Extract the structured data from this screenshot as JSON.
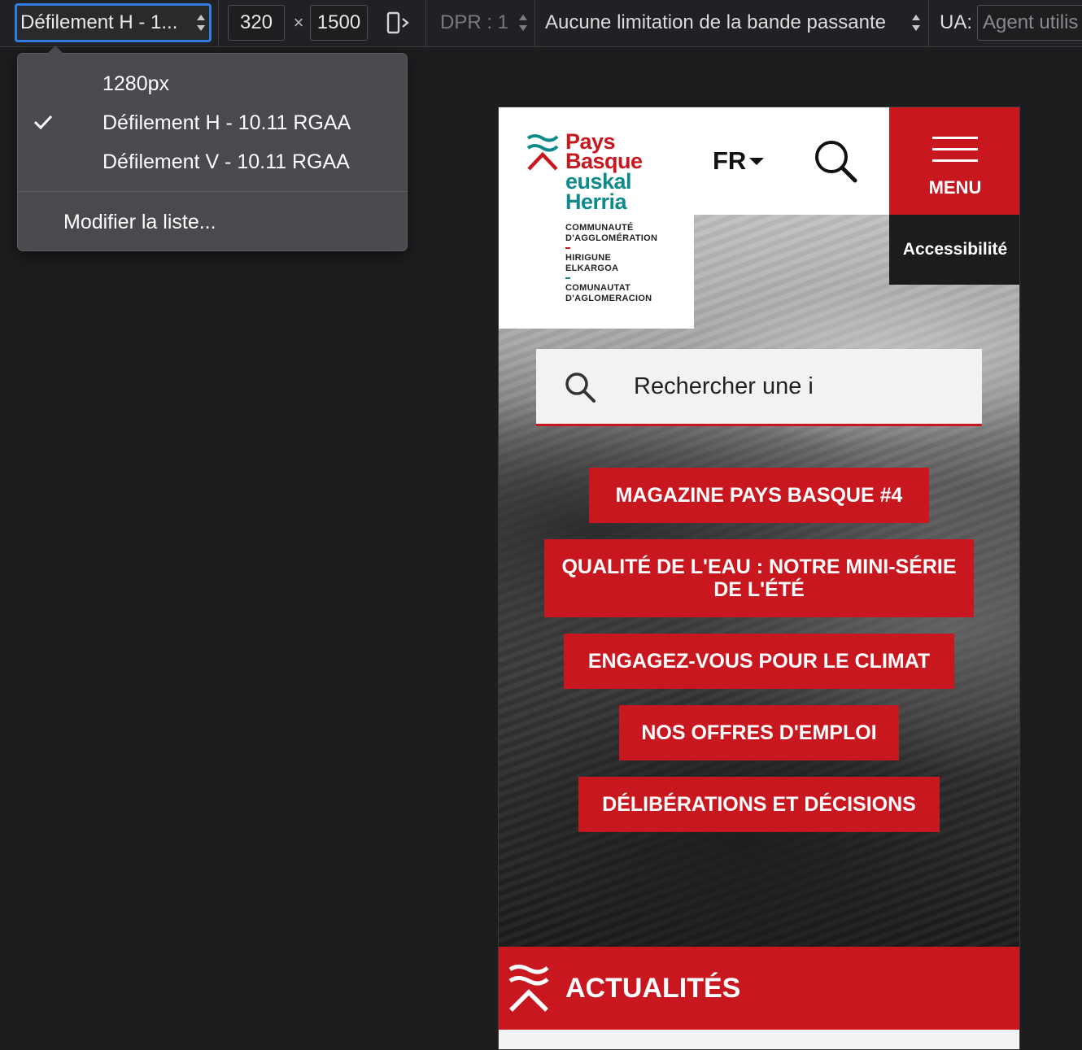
{
  "toolbar": {
    "device_select_label": "Défilement H - 1...",
    "width_value": "320",
    "times_symbol": "×",
    "height_value": "1500",
    "dpr_label": "DPR : 1",
    "throttle_label": "Aucune limitation de la bande passante",
    "ua_label": "UA:",
    "ua_placeholder": "Agent utilis",
    "rotate_icon": "rotate-device-icon"
  },
  "device_menu": {
    "items": [
      {
        "label": "1280px",
        "checked": false
      },
      {
        "label": "Défilement H - 10.11 RGAA",
        "checked": true
      },
      {
        "label": "Défilement V - 10.11 RGAA",
        "checked": false
      }
    ],
    "edit_label": "Modifier la liste..."
  },
  "site": {
    "logo": {
      "line1": "Pays",
      "line2": "Basque",
      "line3": "euskal",
      "line4": "Herria",
      "sub1": "COMMUNAUTÉ",
      "sub2": "D'AGGLOMÉRATION",
      "sub3": "HIRIGUNE",
      "sub4": "ELKARGOA",
      "sub5": "COMUNAUTAT",
      "sub6": "D'AGLOMERACION"
    },
    "language": "FR",
    "menu_label": "MENU",
    "accessibility_label": "Accessibilité",
    "search_placeholder": "Rechercher une i",
    "cta_buttons": [
      "MAGAZINE PAYS BASQUE #4",
      "QUALITÉ DE L'EAU : NOTRE MINI-SÉRIE DE L'ÉTÉ",
      "ENGAGEZ-VOUS POUR LE CLIMAT",
      "NOS OFFRES D'EMPLOI",
      "DÉLIBÉRATIONS ET DÉCISIONS"
    ],
    "news_title": "ACTUALITÉS"
  },
  "colors": {
    "brand_red": "#c8171f",
    "brand_teal": "#0f8a8c",
    "devtools_bg": "#202124",
    "focus_blue": "#2f7de1"
  }
}
